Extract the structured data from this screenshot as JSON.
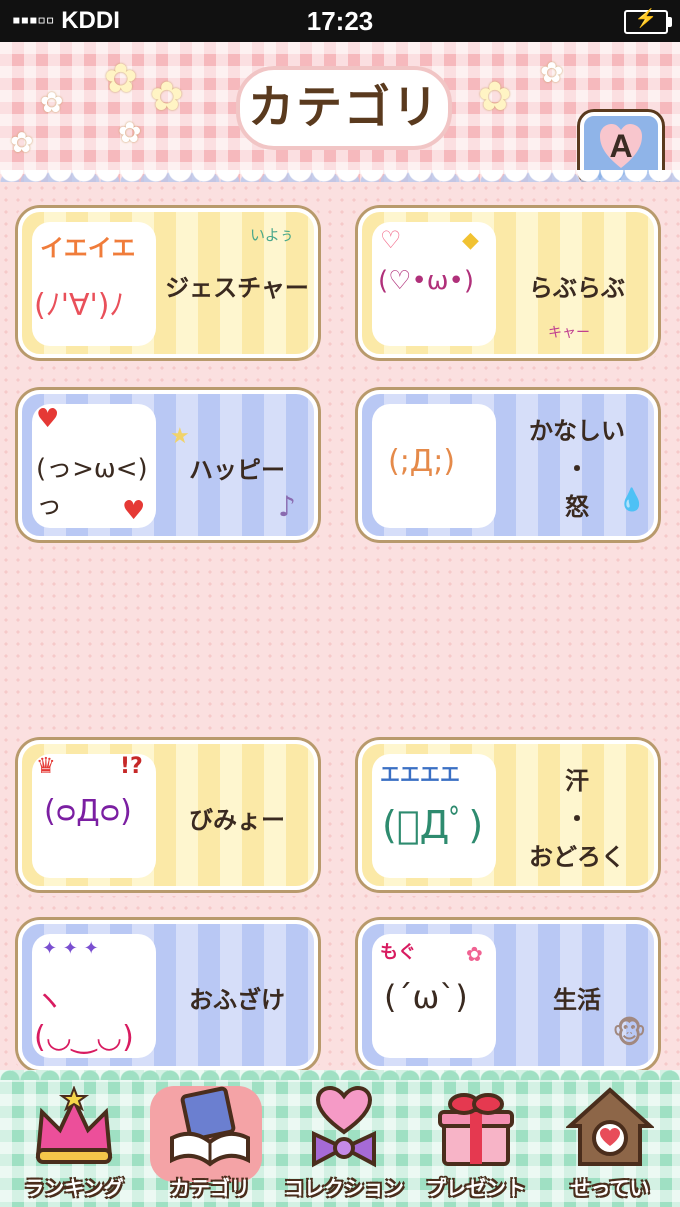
{
  "status_bar": {
    "carrier": "▪▪▪▫▫ KDDI",
    "time": "17:23"
  },
  "header": {
    "title": "カテゴリ",
    "font_button_label": "A"
  },
  "categories": [
    {
      "label": "ジェスチャー",
      "thumb_text": "イエイエ",
      "thumb_face": "(ﾉ'∀')ﾉ",
      "deco_text": "いよぅ"
    },
    {
      "label": "らぶらぶ",
      "thumb_face": "(♡•ω•)",
      "deco_text": "キャー"
    },
    {
      "label": "ハッピー",
      "thumb_face": "(っ>ω<)っ"
    },
    {
      "lines": [
        "かなしい",
        "・",
        "怒"
      ],
      "thumb_face": "(;Д;)"
    },
    {
      "label": "びみょー",
      "thumb_face": "(ᴑДᴑ)",
      "deco_text": "!?"
    },
    {
      "lines": [
        "汗",
        "・",
        "おどろく"
      ],
      "thumb_text": "エエエエ",
      "thumb_face": "(ﾟДﾟ)"
    },
    {
      "label": "おふざけ",
      "thumb_face": "ヽ(◡‿◡)ノ"
    },
    {
      "label": "生活",
      "thumb_text": "もぐ",
      "thumb_face": "(´ω`)"
    }
  ],
  "tabs": [
    {
      "label": "ランキング",
      "icon": "crown-icon",
      "active": false
    },
    {
      "label": "カテゴリ",
      "icon": "book-icon",
      "active": true
    },
    {
      "label": "コレクション",
      "icon": "heart-ribbon-icon",
      "active": false
    },
    {
      "label": "プレゼント",
      "icon": "gift-icon",
      "active": false
    },
    {
      "label": "せってい",
      "icon": "gear-house-icon",
      "active": false
    }
  ],
  "colors": {
    "header_pink": "#f6b9bd",
    "content_bg": "#fbe0e0",
    "card_yellow": "#fbe9a7",
    "card_blue": "#b9c8f4",
    "tab_mint": "#9fe0c3",
    "text_brown": "#3a2a20"
  }
}
